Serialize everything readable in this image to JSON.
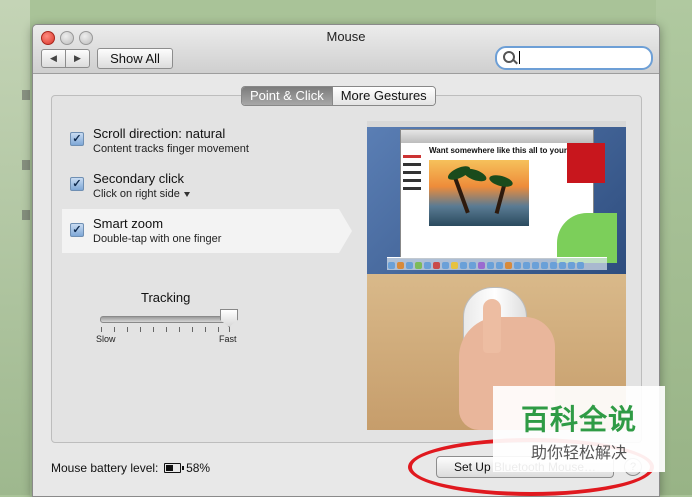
{
  "window": {
    "title": "Mouse"
  },
  "toolbar": {
    "back": "◀",
    "forward": "▶",
    "show_all": "Show All",
    "search_value": ""
  },
  "tabs": [
    {
      "label": "Point & Click",
      "active": true
    },
    {
      "label": "More Gestures",
      "active": false
    }
  ],
  "options": [
    {
      "title": "Scroll direction: natural",
      "subtitle": "Content tracks finger movement",
      "checked": true
    },
    {
      "title": "Secondary click",
      "subtitle": "Click on right side",
      "checked": true,
      "has_dropdown": true
    },
    {
      "title": "Smart zoom",
      "subtitle": "Double-tap with one finger",
      "checked": true,
      "selected": true
    }
  ],
  "tracking": {
    "label": "Tracking",
    "min_label": "Slow",
    "max_label": "Fast",
    "value_fraction": 1.0
  },
  "preview": {
    "headline": "Want somewhere like this all to yourself?"
  },
  "status": {
    "battery_label": "Mouse battery level:",
    "battery_value": "58%"
  },
  "buttons": {
    "setup_bluetooth": "Set Up Bluetooth Mouse…",
    "help": "?"
  },
  "watermark": {
    "main": "百科全说",
    "sub": "助你轻松解决"
  },
  "colors": {
    "annotation_circle": "#e0191f",
    "watermark_green": "#2f9b45"
  }
}
